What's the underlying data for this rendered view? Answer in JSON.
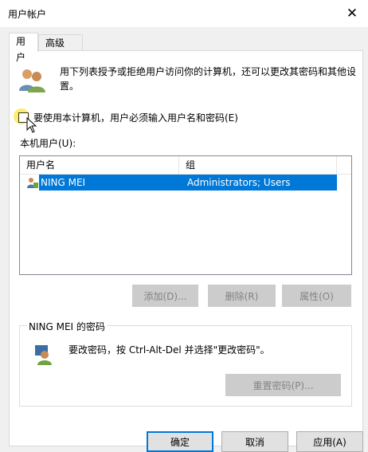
{
  "window": {
    "title": "用户帐户",
    "close_glyph": "✕"
  },
  "tabs": [
    {
      "label": "用户",
      "active": true
    },
    {
      "label": "高级",
      "active": false
    }
  ],
  "intro_text": "用下列表授予或拒绝用户访问你的计算机，还可以更改其密码和其他设置。",
  "require_login": {
    "label": "要使用本计算机，用户必须输入用户名和密码(E)",
    "checked": false
  },
  "local_users_label": "本机用户(U):",
  "table": {
    "columns": [
      "用户名",
      "组"
    ],
    "rows": [
      {
        "username": "NING MEI",
        "group": "Administrators; Users",
        "selected": true
      }
    ]
  },
  "buttons": {
    "add": "添加(D)...",
    "remove": "删除(R)",
    "properties": "属性(O)"
  },
  "password_group": {
    "title": "NING MEI 的密码",
    "text": "要改密码，按 Ctrl-Alt-Del 并选择\"更改密码\"。",
    "reset_button": "重置密码(P)..."
  },
  "footer": {
    "ok": "确定",
    "cancel": "取消",
    "apply": "应用(A)"
  },
  "colors": {
    "selection": "#0078d7",
    "window_bg": "#f0f0f0",
    "disabled_button": "#cccccc"
  }
}
